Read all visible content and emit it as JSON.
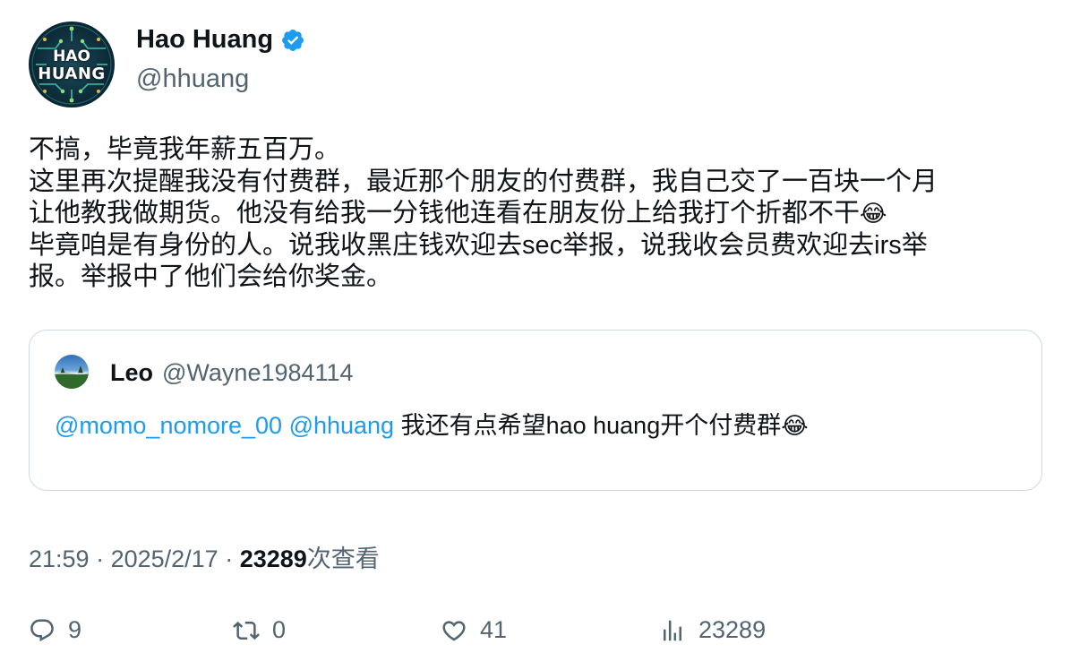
{
  "author": {
    "display_name": "Hao Huang",
    "handle": "@hhuang",
    "verified": true,
    "avatar_text_line1": "HAO",
    "avatar_text_line2": "HUANG"
  },
  "tweet": {
    "lines": [
      "不搞，毕竟我年薪五百万。",
      "这里再次提醒我没有付费群，最近那个朋友的付费群，我自己交了一百块一个月",
      "让他教我做期货。他没有给我一分钱他连看在朋友份上给我打个折都不干",
      "毕竟咱是有身份的人。说我收黑庄钱欢迎去sec举报，说我收会员费欢迎去irs举",
      "报。举报中了他们会给你奖金。"
    ],
    "emoji": "😂"
  },
  "quoted": {
    "name": "Leo",
    "handle": "@Wayne1984114",
    "mention1": "@momo_nomore_00",
    "mention2": "@hhuang",
    "text": " 我还有点希望hao huang开个付费群",
    "emoji": "😂"
  },
  "meta": {
    "time": "21:59",
    "separator1": " · ",
    "date": "2025/2/17",
    "separator2": " · ",
    "views_count": "23289",
    "views_label": "次查看"
  },
  "actions": {
    "replies": "9",
    "retweets": "0",
    "likes": "41",
    "views": "23289"
  },
  "colors": {
    "text": "#0f1419",
    "secondary": "#536471",
    "link": "#1d9bf0",
    "verified": "#1d9bf0",
    "border": "#cfd9de"
  }
}
